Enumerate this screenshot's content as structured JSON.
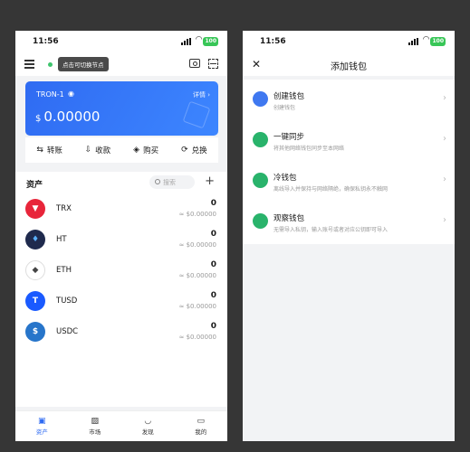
{
  "status": {
    "time": "11:56",
    "battery": "100"
  },
  "wallet_screen": {
    "node_tip": "点击可切换节点",
    "network": "TRON-1",
    "detail_label": "详情",
    "balance_currency": "$",
    "balance": "0.00000",
    "actions": [
      {
        "label": "转账",
        "icon": "transfer-icon",
        "glyph": "⇆"
      },
      {
        "label": "收款",
        "icon": "receive-icon",
        "glyph": "⇩"
      },
      {
        "label": "购买",
        "icon": "buy-icon",
        "glyph": "◈"
      },
      {
        "label": "兑换",
        "icon": "swap-icon",
        "glyph": "⟳"
      }
    ],
    "assets_title": "资产",
    "search_placeholder": "搜索",
    "add_label": "+",
    "assets": [
      {
        "symbol": "TRX",
        "amount": "0",
        "fiat": "≈ $0.00000",
        "color": "#e8253a",
        "glyph": "▼"
      },
      {
        "symbol": "HT",
        "amount": "0",
        "fiat": "≈ $0.00000",
        "color": "#1f2a4d",
        "glyph": "♦"
      },
      {
        "symbol": "ETH",
        "amount": "0",
        "fiat": "≈ $0.00000",
        "color": "#ffffff",
        "glyph": "◆"
      },
      {
        "symbol": "TUSD",
        "amount": "0",
        "fiat": "≈ $0.00000",
        "color": "#1a5aff",
        "glyph": "T"
      },
      {
        "symbol": "USDC",
        "amount": "0",
        "fiat": "≈ $0.00000",
        "color": "#2775ca",
        "glyph": "$"
      }
    ],
    "tabs": [
      {
        "label": "资产",
        "glyph": "▣",
        "active": true
      },
      {
        "label": "市场",
        "glyph": "▨",
        "active": false
      },
      {
        "label": "发现",
        "glyph": "◡",
        "active": false
      },
      {
        "label": "我的",
        "glyph": "▭",
        "active": false
      }
    ]
  },
  "add_wallet_screen": {
    "title": "添加钱包",
    "close_glyph": "✕",
    "options": [
      {
        "title": "创建钱包",
        "subtitle": "创建钱包",
        "color": "#3f78f0"
      },
      {
        "title": "一键同步",
        "subtitle": "将其他网络钱包同步至本网络",
        "color": "#29b36b"
      },
      {
        "title": "冷钱包",
        "subtitle": "离线导入并保持与网络隔绝，确保私钥永不触网",
        "color": "#29b36b"
      },
      {
        "title": "观察钱包",
        "subtitle": "无需导入私钥，输入账号或者对应公钥即可导入",
        "color": "#29b36b"
      }
    ]
  }
}
